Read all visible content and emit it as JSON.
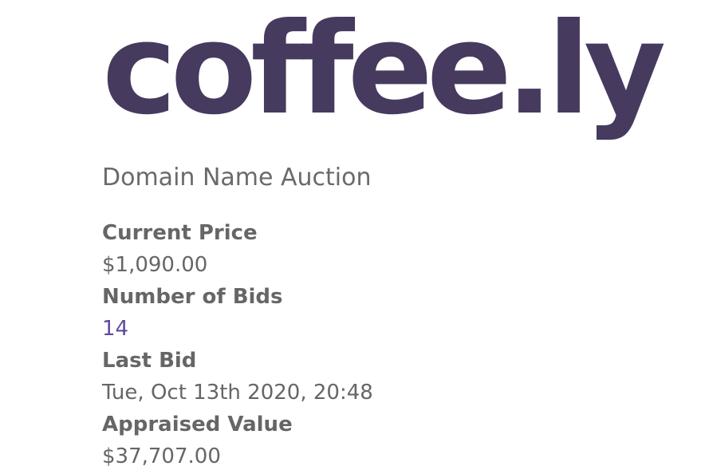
{
  "logo": {
    "text": "coffee.ly",
    "color": "#463a5e"
  },
  "subtitle": "Domain Name Auction",
  "details": {
    "current_price": {
      "label": "Current Price",
      "value": "$1,090.00"
    },
    "number_of_bids": {
      "label": "Number of Bids",
      "value": "14",
      "value_color": "#5e4a9c"
    },
    "last_bid": {
      "label": "Last Bid",
      "value": "Tue, Oct 13th 2020, 20:48"
    },
    "appraised_value": {
      "label": "Appraised Value",
      "value": "$37,707.00"
    }
  }
}
